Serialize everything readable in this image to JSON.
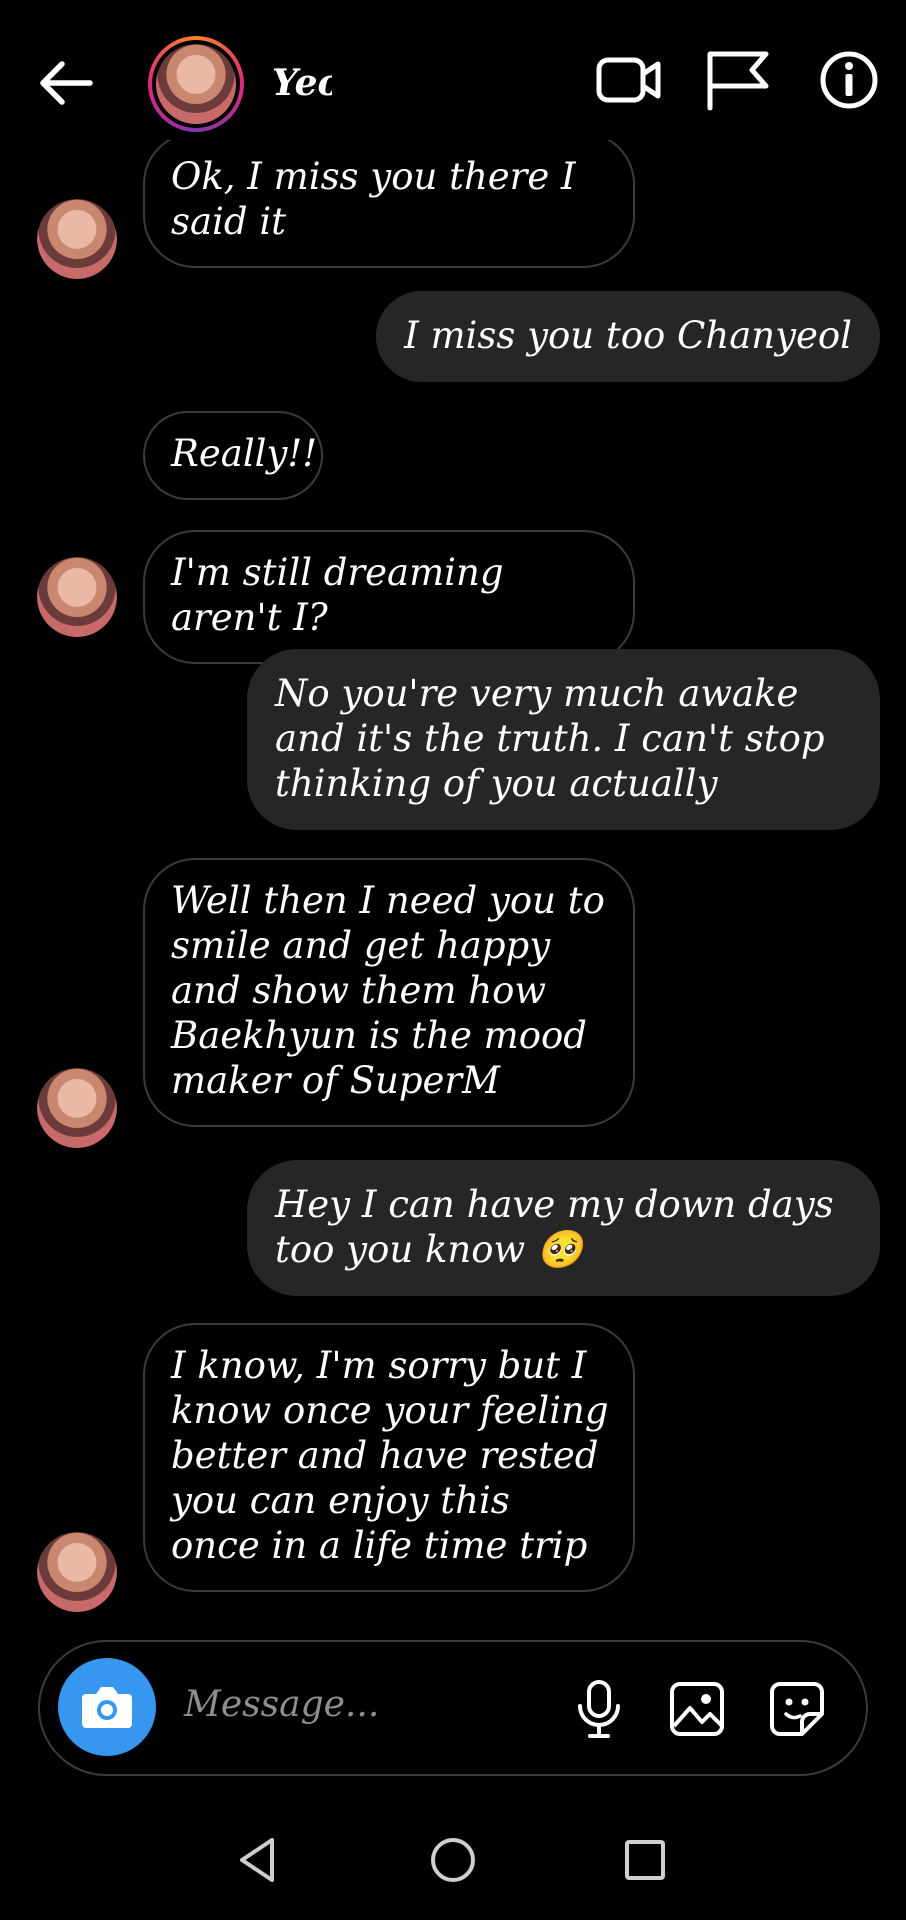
{
  "header": {
    "name": "Yeol"
  },
  "messages": [
    {
      "dir": "in",
      "text": "Ok, I miss you there I said it"
    },
    {
      "dir": "out",
      "text": "I miss you too Chanyeol"
    },
    {
      "dir": "in",
      "text": "Really!!"
    },
    {
      "dir": "in",
      "text": "I'm still dreaming aren't I?"
    },
    {
      "dir": "out",
      "text": "No you're very much awake and it's the truth. I can't stop thinking of you actually"
    },
    {
      "dir": "in",
      "text": "Well then I need you to smile and get happy and show them how Baekhyun is the mood maker of SuperM"
    },
    {
      "dir": "out",
      "text": "Hey I can have my down days too you know 🥺"
    },
    {
      "dir": "in",
      "text": "I know, I'm sorry but I know once your feeling better and have rested you can enjoy this once in a life time trip"
    }
  ],
  "composer": {
    "placeholder": "Message..."
  },
  "colors": {
    "accent": "#3797f0",
    "outgoing_bubble": "#262626",
    "incoming_border": "#3b3b3b"
  },
  "icons": [
    "back-arrow-icon",
    "video-call-icon",
    "flag-icon",
    "info-icon",
    "camera-icon",
    "microphone-icon",
    "gallery-icon",
    "sticker-icon",
    "nav-back-icon",
    "nav-home-icon",
    "nav-recents-icon"
  ]
}
